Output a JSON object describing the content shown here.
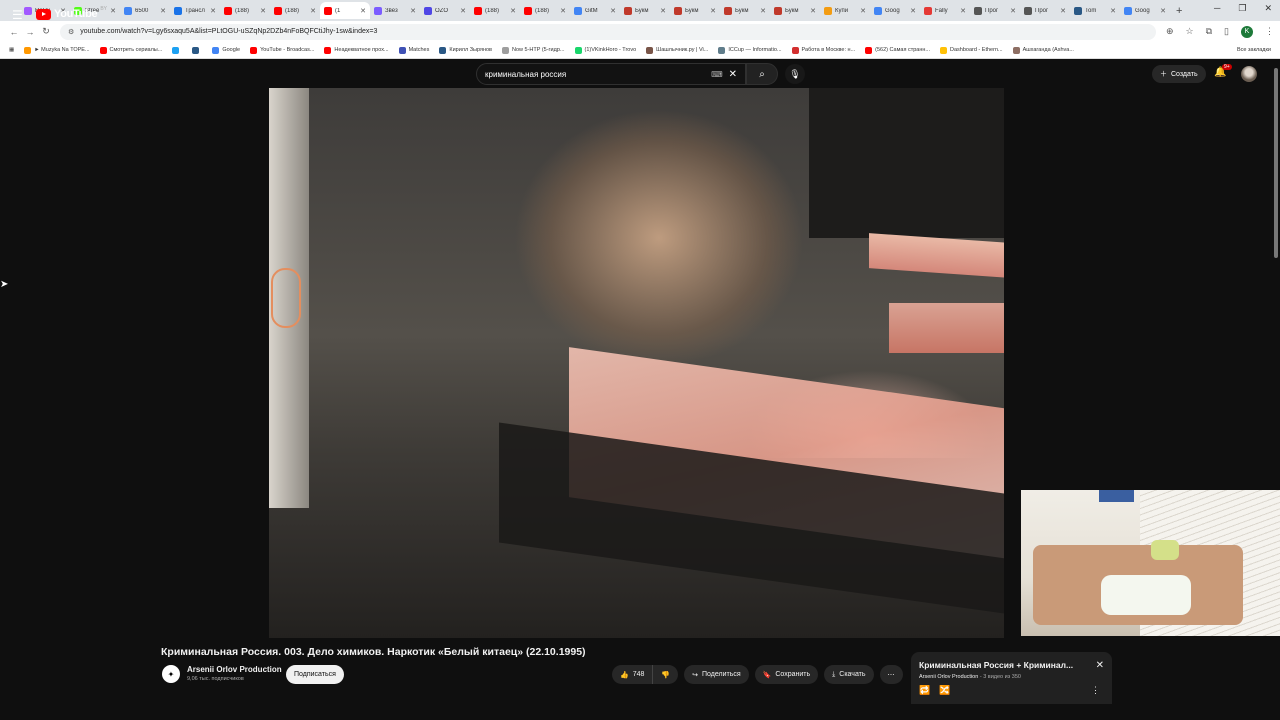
{
  "browser": {
    "tabs": [
      {
        "label": "ReHy",
        "color": "#a259ff"
      },
      {
        "label": "Stree",
        "color": "#53fc18"
      },
      {
        "label": "6500",
        "color": "#4285f4"
      },
      {
        "label": "Трансл",
        "color": "#1a73e8"
      },
      {
        "label": "(188)",
        "color": "#ff0000"
      },
      {
        "label": "(188)",
        "color": "#ff0000"
      },
      {
        "label": "(1",
        "color": "#ff0000"
      },
      {
        "label": "Звез",
        "color": "#7b5cff"
      },
      {
        "label": "OZO",
        "color": "#4f46e5"
      },
      {
        "label": "(188)",
        "color": "#ff0000"
      },
      {
        "label": "(188)",
        "color": "#ff0000"
      },
      {
        "label": "GitM",
        "color": "#4285f4"
      },
      {
        "label": "Букм",
        "color": "#c0392b"
      },
      {
        "label": "Букм",
        "color": "#c0392b"
      },
      {
        "label": "Букм",
        "color": "#c0392b"
      },
      {
        "label": "Букм",
        "color": "#c0392b"
      },
      {
        "label": "Купи",
        "color": "#f39c12"
      },
      {
        "label": "Goog",
        "color": "#4285f4"
      },
      {
        "label": "Fally",
        "color": "#e53935"
      },
      {
        "label": "Прог",
        "color": "#555555"
      },
      {
        "label": "Прог",
        "color": "#555555"
      },
      {
        "label": "Tom",
        "color": "#2a5885"
      },
      {
        "label": "Goog",
        "color": "#4285f4"
      }
    ],
    "url": "youtube.com/watch?v=Lgy6sxaqu5A&list=PLtOGU-uSZqNp2DZb4nFoBQFCtiJhy-1sw&index=3",
    "profile_letter": "K",
    "bookmarks": [
      {
        "label": "► Muzyka Na ТОРЕ...",
        "color": "#ff9800"
      },
      {
        "label": "Смотреть сериалы...",
        "color": "#ff0000"
      },
      {
        "label": "",
        "color": "#1da1f2"
      },
      {
        "label": "",
        "color": "#2a5885"
      },
      {
        "label": "Google",
        "color": "#4285f4"
      },
      {
        "label": "YouTube - Broadcas...",
        "color": "#ff0000"
      },
      {
        "label": "Неадекватное прох...",
        "color": "#ff0000"
      },
      {
        "label": "Matches",
        "color": "#3f51b5"
      },
      {
        "label": "Кирилл Зырянов",
        "color": "#2a5885"
      },
      {
        "label": "Now 5-HTP (5-гидр...",
        "color": "#9e9e9e"
      },
      {
        "label": "(1)VKinkHoro - Trovo",
        "color": "#19d66b"
      },
      {
        "label": "Шашлычник.ру | Vi...",
        "color": "#795548"
      },
      {
        "label": "ICCup — Informatio...",
        "color": "#607d8b"
      },
      {
        "label": "Работа в Москве: н...",
        "color": "#d32f2f"
      },
      {
        "label": "(562) Самая странн...",
        "color": "#ff0000"
      },
      {
        "label": "Dashboard - Ethern...",
        "color": "#ffc107"
      },
      {
        "label": "Ашхаганда (Ashva...",
        "color": "#8d6e63"
      }
    ],
    "bookmarks_all": "Все закладки"
  },
  "youtube": {
    "logo_text": "YouTube",
    "region": "BY",
    "search_query": "криминальная россия",
    "create_label": "Создать",
    "notifications_badge": "9+"
  },
  "video": {
    "title": "Криминальная Россия. 003. Дело химиков. Наркотик «Белый китаец» (22.10.1995)",
    "channel_name": "Arsenii Orlov Production",
    "channel_subs": "9,06 тыс. подписчиков",
    "subscribe_label": "Подписаться",
    "likes": "748",
    "share_label": "Поделиться",
    "save_label": "Сохранить",
    "download_label": "Скачать"
  },
  "playlist": {
    "title": "Криминальная Россия + Криминал...",
    "owner": "Arsenii Orlov Production",
    "position": "3 видео из 350"
  },
  "colors": {
    "background": "#0f0f0f",
    "brand_red": "#ff0000",
    "pill_bg": "#272727"
  }
}
